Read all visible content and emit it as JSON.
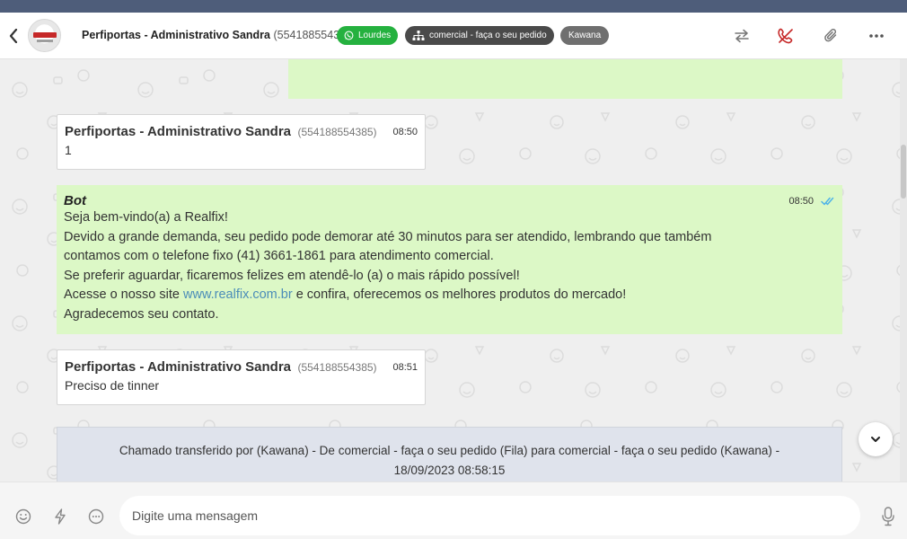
{
  "header": {
    "contact_name": "Perfiportas - Administrativo Sandra",
    "contact_phone": "(554188554385)",
    "tags": [
      {
        "label": "Lourdes",
        "icon": "whatsapp-icon",
        "color": "#25b13f"
      },
      {
        "label": "comercial - faça o seu pedido",
        "icon": "sitemap-icon",
        "color": "#4a4a4a"
      },
      {
        "label": "Kawana",
        "color": "#6f6f6f"
      }
    ],
    "icons": [
      "back-icon",
      "transfer-icon",
      "end-call-icon",
      "attach-icon",
      "more-icon"
    ]
  },
  "messages": [
    {
      "type": "incoming",
      "sender": "Perfiportas - Administrativo Sandra",
      "phone": "(554188554385)",
      "time": "08:50",
      "text": "1"
    },
    {
      "type": "bot",
      "sender": "Bot",
      "time": "08:50",
      "lines": [
        "Seja bem-vindo(a) a Realfix!",
        "Devido a grande demanda, seu pedido pode demorar até 30 minutos para ser atendido, lembrando que também",
        "contamos com o telefone fixo (41) 3661-1861 para atendimento comercial.",
        "Se preferir aguardar, ficaremos felizes em atendê-lo (a) o mais rápido possível!"
      ],
      "site_prefix": "Acesse o nosso site ",
      "site_link": "www.realfix.com.br",
      "site_suffix": " e confira, oferecemos os melhores produtos do mercado!",
      "closing": "Agradecemos seu contato."
    },
    {
      "type": "incoming",
      "sender": "Perfiportas - Administrativo Sandra",
      "phone": "(554188554385)",
      "time": "08:51",
      "text": "Preciso de tinner"
    }
  ],
  "system_message": {
    "line1": "Chamado transferido por (Kawana) - De comercial - faça o seu pedido (Fila) para comercial - faça o seu pedido (Kawana) -",
    "line2": "18/09/2023 08:58:15"
  },
  "composer": {
    "placeholder": "Digite uma mensagem"
  },
  "colors": {
    "outgoing_bubble": "#dcf8c6",
    "incoming_bubble": "#ffffff",
    "system_bubble": "#dfe3ec",
    "tag_green": "#25b13f",
    "link": "#4b8db8",
    "end_call": "#c62828"
  }
}
